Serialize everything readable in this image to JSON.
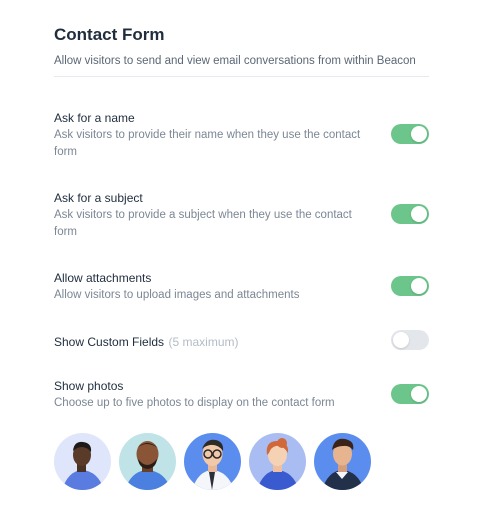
{
  "header": {
    "title": "Contact Form",
    "subtitle": "Allow visitors to send and view email conversations from within Beacon"
  },
  "settings": [
    {
      "label": "Ask for a name",
      "description": "Ask visitors to provide their name when they use the contact form",
      "enabled": true
    },
    {
      "label": "Ask for a subject",
      "description": "Ask visitors to provide a subject when they use the contact form",
      "enabled": true
    },
    {
      "label": "Allow attachments",
      "description": "Allow visitors to upload images and attachments",
      "enabled": true
    },
    {
      "label": "Show Custom Fields",
      "hint": "(5 maximum)",
      "enabled": false
    },
    {
      "label": "Show photos",
      "description": "Choose up to five photos to display on the contact form",
      "enabled": true
    }
  ],
  "photos": [
    {
      "icon": "avatar-photo-1",
      "bg": "#dfe6fb"
    },
    {
      "icon": "avatar-photo-2",
      "bg": "#bfe3e6"
    },
    {
      "icon": "avatar-photo-3",
      "bg": "#5b8def"
    },
    {
      "icon": "avatar-photo-4",
      "bg": "#a9bdf3"
    },
    {
      "icon": "avatar-photo-5",
      "bg": "#5b8def"
    }
  ],
  "colors": {
    "toggle_on": "#6cc58a",
    "toggle_off": "#e3e7ec"
  }
}
